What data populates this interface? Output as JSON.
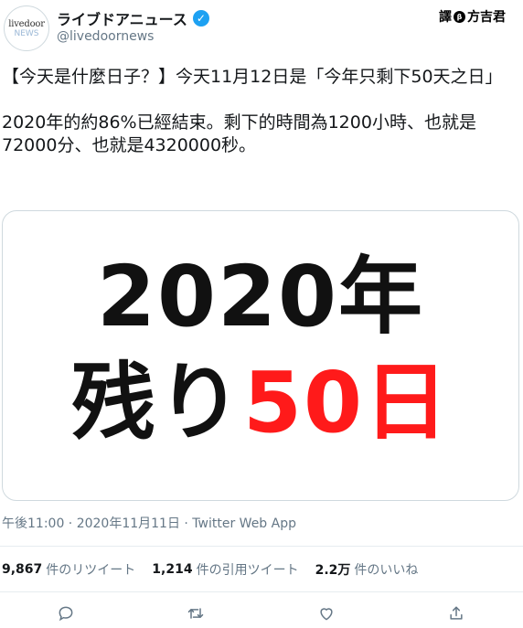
{
  "account": {
    "avatar_line1": "livedoor",
    "avatar_line2": "NEWS",
    "display_name": "ライブドアニュース",
    "verified_glyph": "✓",
    "handle": "@livedoornews"
  },
  "translator": {
    "label_left": "譯",
    "label_mid": "β",
    "label_right": "方吉君"
  },
  "tweet": {
    "text": "【今天是什麼日子？】今天11月12日是「今年只剩下50天之日」\n\n2020年的約86%已經結束。剩下的時間為1200小時、也就是72000分、也就是4320000秒。"
  },
  "media": {
    "line1": "2020年",
    "line2_black": "残り",
    "line2_red": "50日",
    "accent_color": "#ff1a1a"
  },
  "meta": {
    "timestamp": "午後11:00 · 2020年11月11日 · Twitter Web App"
  },
  "stats": [
    {
      "num": "9,867",
      "label": "件のリツイート"
    },
    {
      "num": "1,214",
      "label": "件の引用ツイート"
    },
    {
      "num": "2.2万",
      "label": "件のいいね"
    }
  ],
  "actions": [
    "reply-icon",
    "retweet-icon",
    "like-icon",
    "share-icon"
  ]
}
